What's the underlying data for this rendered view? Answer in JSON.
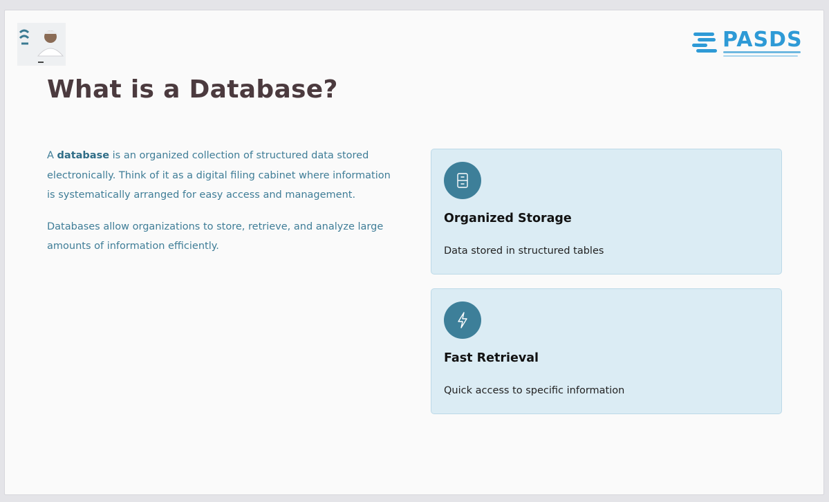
{
  "header": {
    "presenter_photo": "presenter-avatar-with-arabic-name-logo",
    "brand_logo": {
      "text": "PASDS",
      "colors": {
        "primary": "#2e9ad6"
      }
    }
  },
  "title": "What is a Database?",
  "intro": {
    "p1_prefix": "A ",
    "p1_bold": "database",
    "p1_suffix": " is an organized collection of structured data stored electronically. Think of it as a digital filing cabinet where information is systematically arranged for easy access and management.",
    "p2": "Databases allow organizations to store, retrieve, and analyze large amounts of information efficiently."
  },
  "cards": [
    {
      "icon": "file-cabinet-icon",
      "title": "Organized Storage",
      "description": "Data stored in structured tables"
    },
    {
      "icon": "lightning-icon",
      "title": "Fast Retrieval",
      "description": "Quick access to specific information"
    }
  ],
  "colors": {
    "title": "#4b3a3e",
    "body_text": "#3f7d97",
    "card_bg": "#dbecf4",
    "icon_circle": "#3d7f99"
  }
}
